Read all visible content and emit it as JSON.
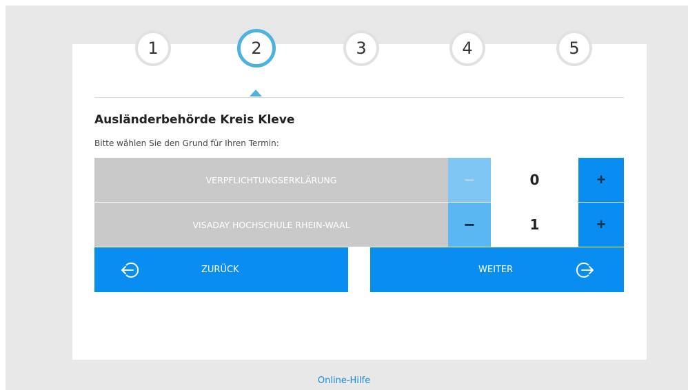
{
  "steps": [
    {
      "label": "1",
      "active": false
    },
    {
      "label": "2",
      "active": true
    },
    {
      "label": "3",
      "active": false
    },
    {
      "label": "4",
      "active": false
    },
    {
      "label": "5",
      "active": false
    }
  ],
  "page": {
    "title": "Ausländerbehörde Kreis Kleve",
    "subtitle": "Bitte wählen Sie den Grund für Ihren Termin:"
  },
  "reasons": [
    {
      "label": "VERPFLICHTUNGSERKLÄRUNG",
      "minus": "−",
      "count": "0",
      "plus": "+"
    },
    {
      "label": "VISADAY HOCHSCHULE RHEIN-WAAL",
      "minus": "−",
      "count": "1",
      "plus": "+"
    }
  ],
  "nav": {
    "back_label": "ZURÜCK",
    "next_label": "WEITER",
    "back_icon": "arrow-left-circle-icon",
    "next_icon": "arrow-right-circle-icon"
  },
  "footer": {
    "help_link": "Online-Hilfe"
  },
  "colors": {
    "accent": "#0a8df0",
    "step_active": "#4db3dc",
    "reason_background": "#c9c9c9",
    "link": "#1a8ad4"
  }
}
